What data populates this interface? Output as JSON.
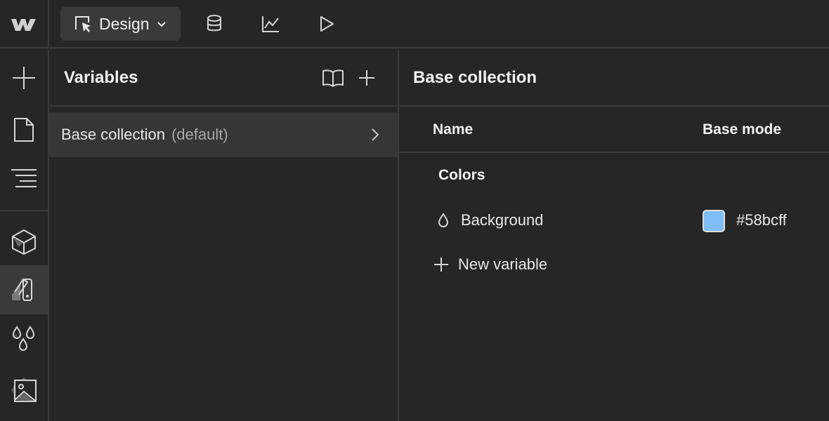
{
  "topbar": {
    "mode_label": "Design",
    "icons": [
      "webflow-logo",
      "cursor-box-icon",
      "chevron-down-icon",
      "database-icon",
      "analytics-icon",
      "play-icon"
    ]
  },
  "rail": {
    "items": [
      "add-icon",
      "page-icon",
      "navigator-icon",
      "components-icon",
      "styles-icon",
      "variables-icon",
      "assets-icon"
    ],
    "active": "styles-icon"
  },
  "variables_panel": {
    "title": "Variables",
    "collection": {
      "name": "Base collection",
      "suffix": "(default)"
    }
  },
  "content": {
    "title": "Base collection",
    "columns": {
      "name": "Name",
      "mode": "Base mode"
    },
    "group": "Colors",
    "variables": [
      {
        "name": "Background",
        "value": "#58bcff",
        "color": "#7fbdf8"
      }
    ],
    "new_variable_label": "New variable"
  }
}
